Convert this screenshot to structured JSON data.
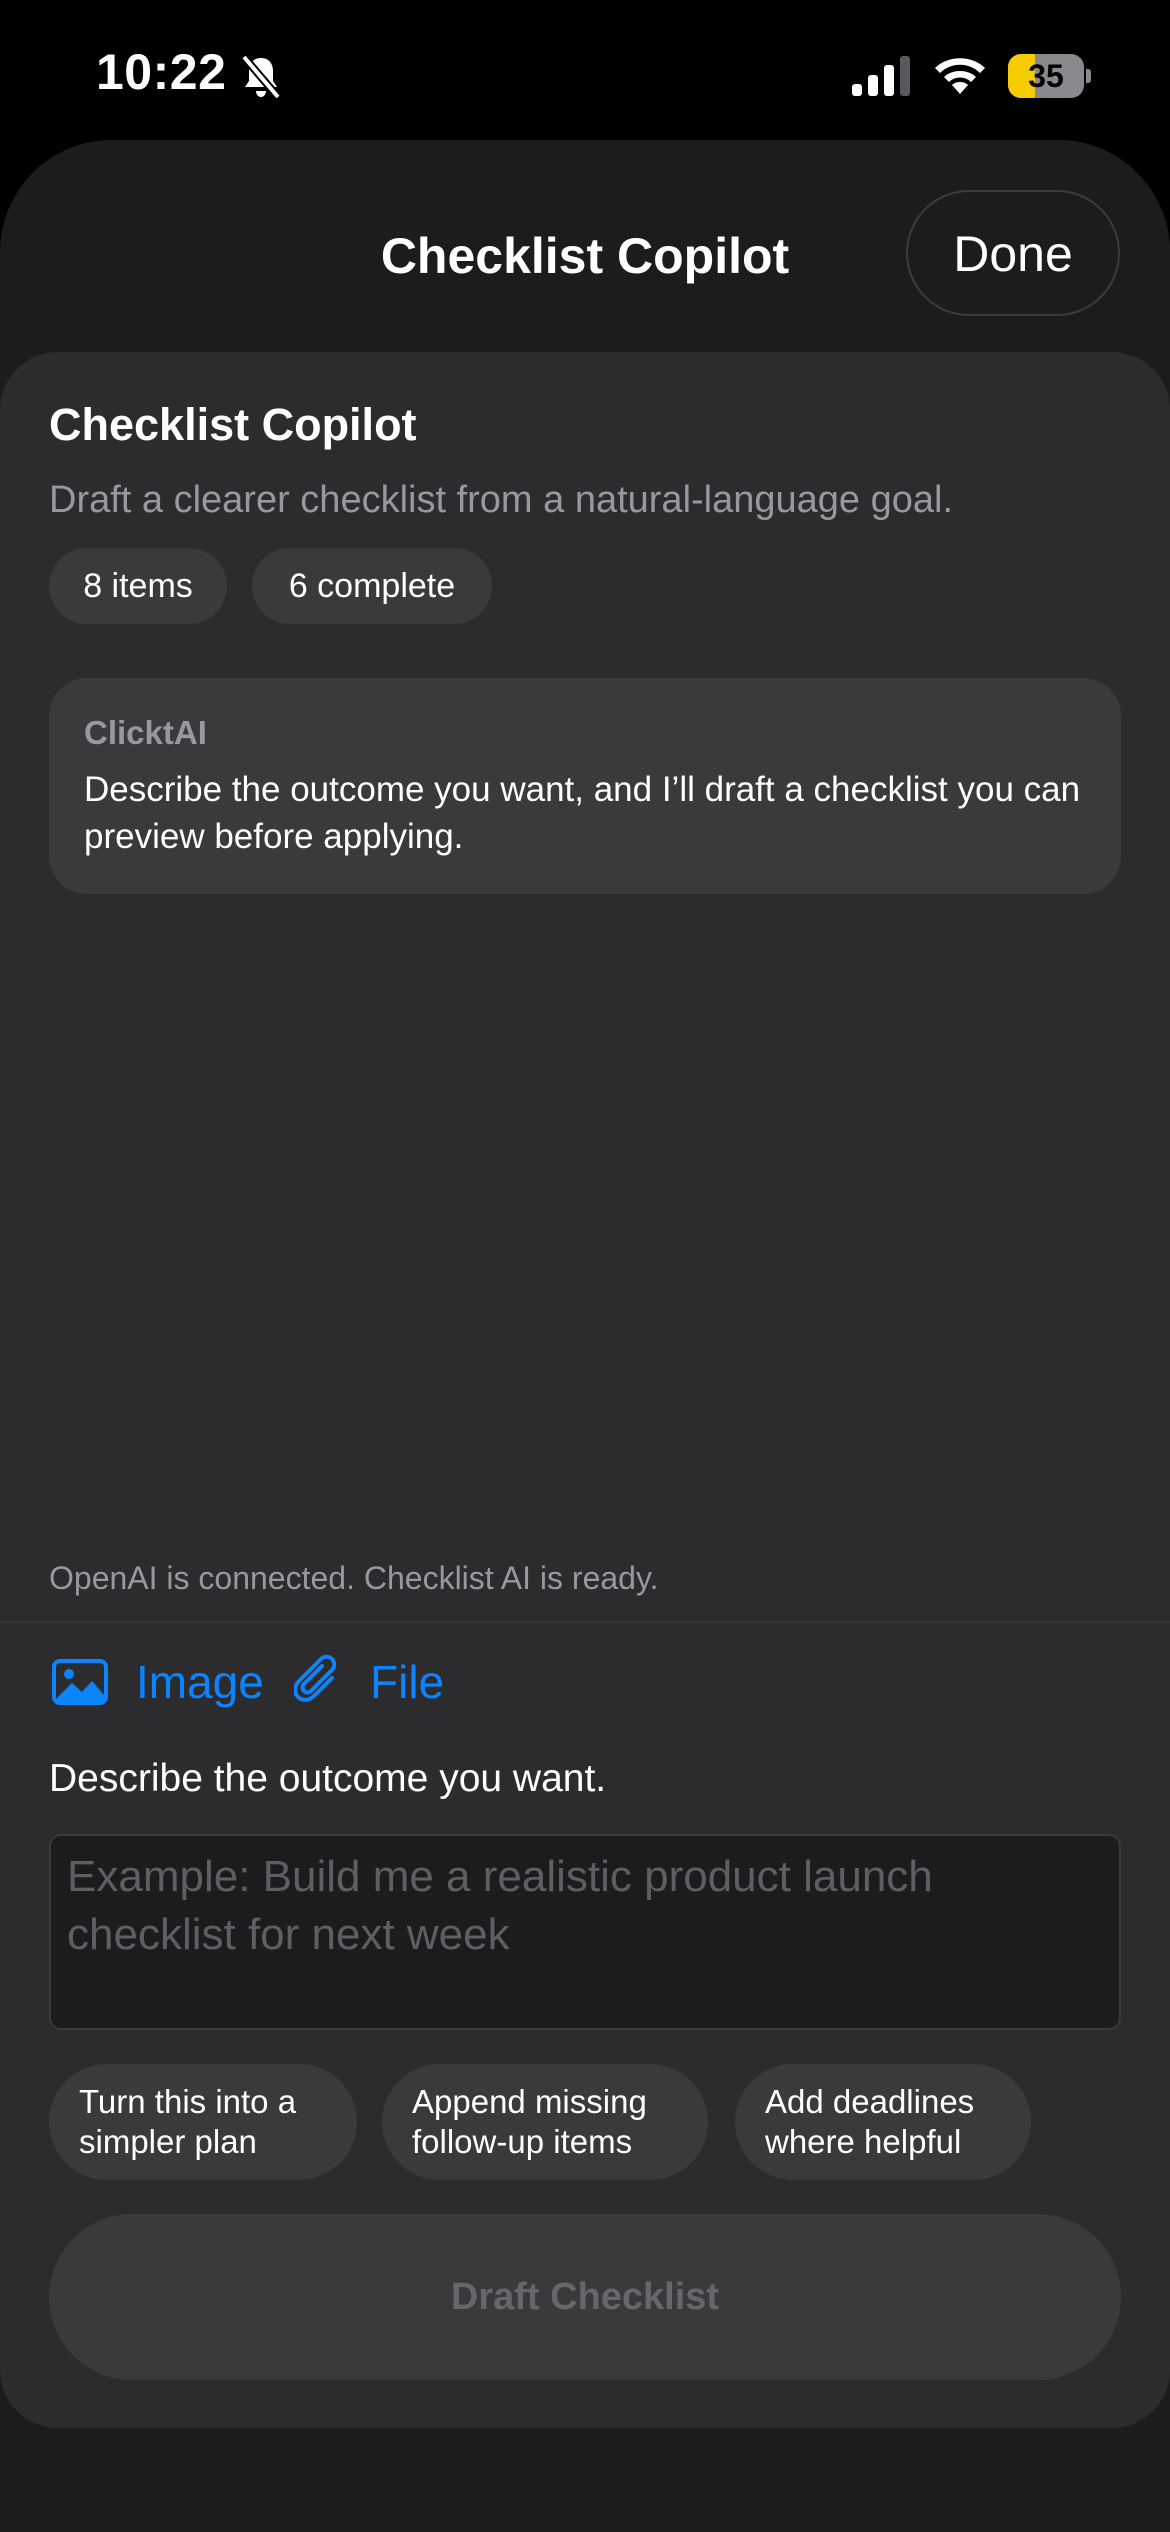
{
  "status_bar": {
    "time": "10:22",
    "battery_percent": 35,
    "battery_label": "35",
    "icons": [
      "bell-slash-icon",
      "cellular-signal-icon",
      "wifi-icon",
      "battery-icon"
    ]
  },
  "nav": {
    "title": "Checklist Copilot",
    "done_label": "Done"
  },
  "card": {
    "title": "Checklist Copilot",
    "subtitle": "Draft a clearer checklist from a natural-language goal.",
    "pills": {
      "items": "8 items",
      "complete": "6 complete"
    }
  },
  "message": {
    "sender": "ClicktAI",
    "text": "Describe the outcome you want, and I’ll draft a checklist you can preview before applying."
  },
  "connection_status": "OpenAI is connected. Checklist AI is ready.",
  "attachments": {
    "image_label": "Image",
    "file_label": "File"
  },
  "prompt": {
    "label": "Describe the outcome you want.",
    "value": "",
    "placeholder": "Example: Build me a realistic product launch checklist for next week"
  },
  "suggestions": [
    "Turn this into a\nsimpler plan",
    "Append missing\nfollow-up items",
    "Add deadlines\nwhere helpful"
  ],
  "draft_button_label": "Draft Checklist",
  "colors": {
    "accent": "#0a84ff",
    "background": "#000000",
    "sheet": "#1c1c1e",
    "card": "#2c2c2e",
    "chip": "#3a3a3c",
    "secondary_text": "#98989f",
    "battery_fill": "#f5cc00"
  }
}
